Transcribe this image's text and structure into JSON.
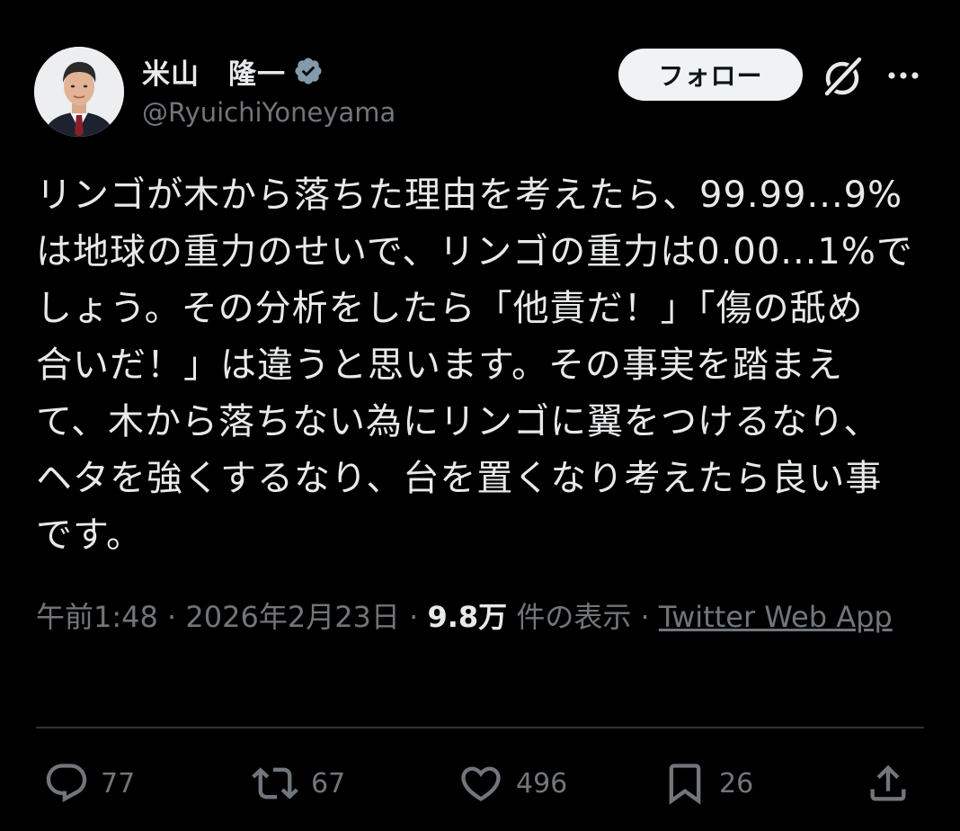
{
  "author": {
    "display_name": "米山　隆一",
    "handle": "@RyuichiYoneyama",
    "verified": true,
    "avatar_icon": "profile-photo"
  },
  "header": {
    "follow_label": "フォロー",
    "grok_icon": "grok-icon",
    "more_icon": "more-icon"
  },
  "tweet": {
    "lines": [
      "リンゴが木から落ちた理由を考えたら、99.99...9%",
      "は地球の重力のせいで、リンゴの重力は0.00...1%で",
      "しょう。その分析をしたら「他責だ！」「傷の舐め",
      "合いだ！」は違うと思います。その事実を踏まえ",
      "て、木から落ちない為にリンゴに翼をつけるなり、",
      "ヘタを強くするなり、台を置くなり考えたら良い事",
      "です。"
    ]
  },
  "meta": {
    "time": "午前1:48",
    "date": "2026年2月23日",
    "views_count": "9.8万",
    "views_label": "件の表示",
    "source": "Twitter Web App",
    "separator": "·"
  },
  "actions": {
    "replies": "77",
    "reposts": "67",
    "likes": "496",
    "bookmarks": "26"
  },
  "colors": {
    "background": "#000000",
    "text_primary": "#e7e9ea",
    "text_secondary": "#71767b",
    "verified_badge": "#829aab",
    "follow_bg": "#eff3f4",
    "divider": "#2f3336"
  }
}
